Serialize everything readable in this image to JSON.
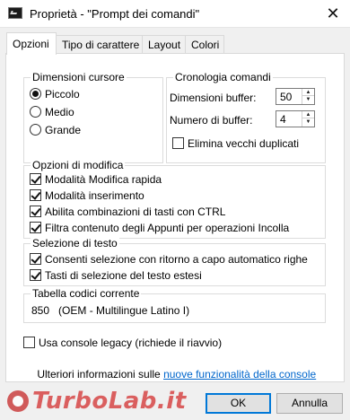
{
  "window": {
    "title": "Proprietà - \"Prompt dei comandi\"",
    "close_glyph": "✕"
  },
  "tabs": [
    {
      "label": "Opzioni",
      "active": true
    },
    {
      "label": "Tipo di carattere",
      "active": false
    },
    {
      "label": "Layout",
      "active": false
    },
    {
      "label": "Colori",
      "active": false
    }
  ],
  "cursor_size": {
    "title": "Dimensioni cursore",
    "options": [
      {
        "label": "Piccolo",
        "selected": true
      },
      {
        "label": "Medio",
        "selected": false
      },
      {
        "label": "Grande",
        "selected": false
      }
    ]
  },
  "history": {
    "title": "Cronologia comandi",
    "buffer_size_label": "Dimensioni buffer:",
    "buffer_size_value": "50",
    "buffer_count_label": "Numero di buffer:",
    "buffer_count_value": "4",
    "discard_duplicates_label": "Elimina vecchi duplicati",
    "discard_duplicates_checked": false
  },
  "edit_options": {
    "title": "Opzioni di modifica",
    "items": [
      {
        "label": "Modalità Modifica rapida",
        "checked": true
      },
      {
        "label": "Modalità inserimento",
        "checked": true
      },
      {
        "label": "Abilita combinazioni di tasti con CTRL",
        "checked": true
      },
      {
        "label": "Filtra contenuto degli Appunti per operazioni Incolla",
        "checked": true
      }
    ]
  },
  "text_selection": {
    "title": "Selezione di testo",
    "items": [
      {
        "label": "Consenti selezione con ritorno a capo automatico righe",
        "checked": true
      },
      {
        "label": "Tasti di selezione del testo estesi",
        "checked": true
      }
    ]
  },
  "codepage": {
    "title": "Tabella codici corrente",
    "value": "850   (OEM - Multilingue Latino I)"
  },
  "legacy": {
    "label": "Usa console legacy (richiede il riavvio)",
    "checked": false
  },
  "more_info": {
    "prefix": "Ulteriori informazioni sulle ",
    "link": "nuove funzionalità della console"
  },
  "buttons": {
    "ok": "OK",
    "cancel": "Annulla"
  },
  "watermark": {
    "text": "TurboLab.it"
  }
}
